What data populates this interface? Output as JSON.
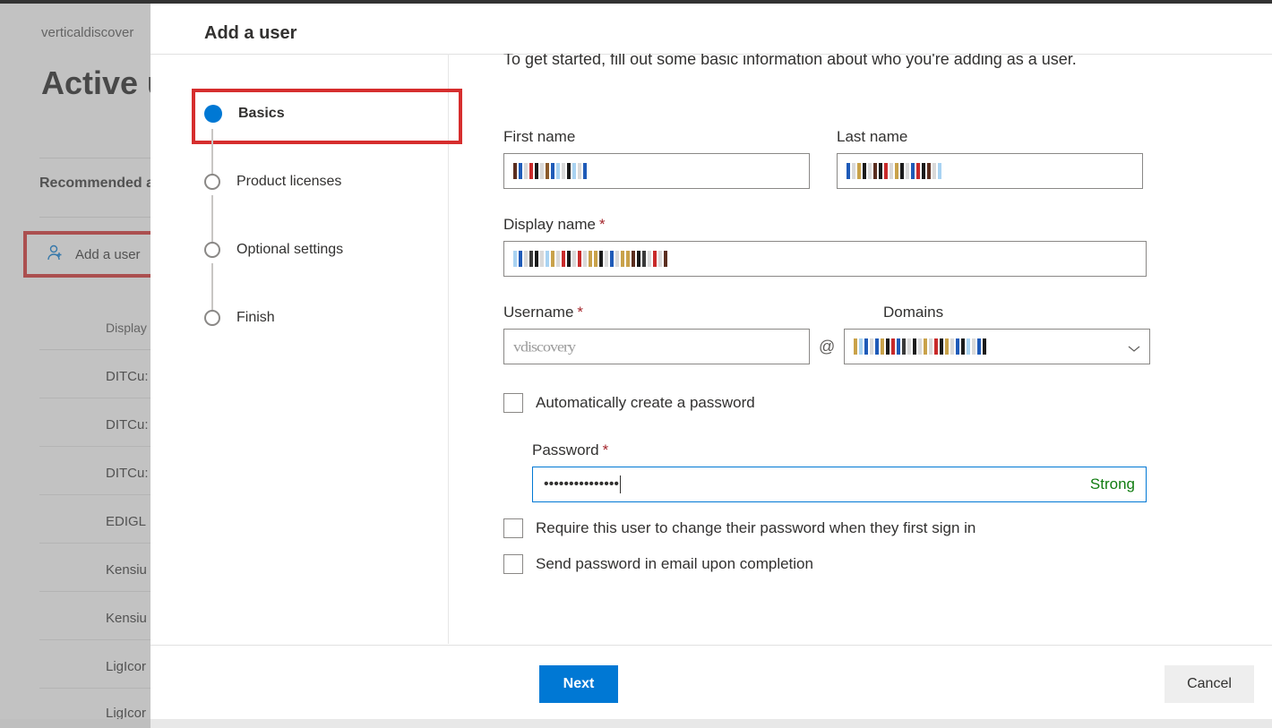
{
  "bg": {
    "breadcrumb": "verticaldiscover",
    "title": "Active u",
    "recommended": "Recommended a",
    "add_user_btn": "Add a user",
    "table_header_display": "Display",
    "rows": [
      "DITCu:",
      "DITCu:",
      "DITCu:",
      "EDIGL",
      "Kensiu",
      "Kensiu",
      "LigIcor",
      "LigIcor"
    ]
  },
  "panel": {
    "title": "Add a user",
    "steps": {
      "basics": "Basics",
      "licenses": "Product licenses",
      "optional": "Optional settings",
      "finish": "Finish"
    }
  },
  "form": {
    "intro": "To get started, fill out some basic information about who you're adding as a user.",
    "first_name_label": "First name",
    "last_name_label": "Last name",
    "display_name_label": "Display name",
    "username_label": "Username",
    "domains_label": "Domains",
    "username_value": "vdiscovery",
    "auto_pwd_label": "Automatically create a password",
    "password_label": "Password",
    "password_dots": "•••••••••••••••",
    "password_strength": "Strong",
    "require_change_label": "Require this user to change their password when they first sign in",
    "send_email_label": "Send password in email upon completion"
  },
  "footer": {
    "next": "Next",
    "cancel": "Cancel"
  }
}
